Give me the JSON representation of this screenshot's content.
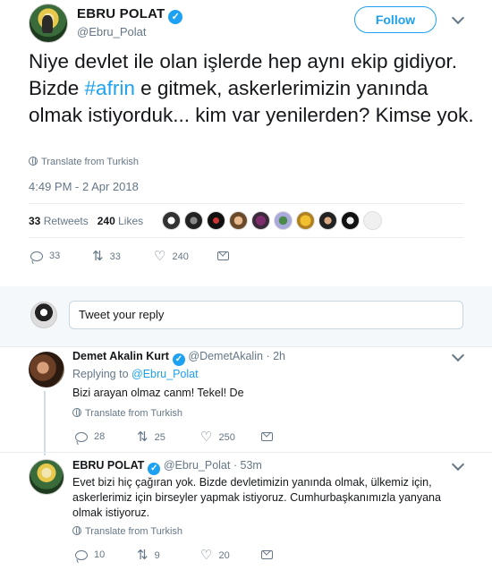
{
  "tweet": {
    "display_name": "EBRU POLAT",
    "handle": "@Ebru_Polat",
    "follow_label": "Follow",
    "text_part1": "Niye devlet ile olan işlerde hep aynı ekip gidiyor. Bizde ",
    "hashtag": "#afrin",
    "text_part2": " e gitmek, askerlerimizin yanında olmak istiyorduk... kim var yenilerden? Kimse yok.",
    "translate_label": "Translate from Turkish",
    "timestamp": "4:49 PM - 2 Apr 2018",
    "retweets_count": "33",
    "retweets_label": "Retweets",
    "likes_count": "240",
    "likes_label": "Likes",
    "actions": {
      "reply_count": "33",
      "retweet_count": "33",
      "like_count": "240"
    }
  },
  "reply_box": {
    "placeholder": "Tweet your reply"
  },
  "replies": [
    {
      "display_name": "Demet Akalin Kurt",
      "handle": "@DemetAkalin",
      "separator": "·",
      "time": "2h",
      "replying_to_label": "Replying to",
      "replying_to_handle": "@Ebru_Polat",
      "text": "Bizi arayan olmaz canm! Tekel! De",
      "translate_label": "Translate from Turkish",
      "reply_count": "28",
      "retweet_count": "25",
      "like_count": "250"
    },
    {
      "display_name": "EBRU POLAT",
      "handle": "@Ebru_Polat",
      "separator": "·",
      "time": "53m",
      "text": "Evet bizi hiç çağıran yok. Bizde devletimizin yanında olmak, ülkemiz için, askerlerimiz için birseyler yapmak istiyoruz. Cumhurbaşkanımızla yanyana olmak istiyoruz.",
      "translate_label": "Translate from Turkish",
      "reply_count": "10",
      "retweet_count": "9",
      "like_count": "20"
    }
  ],
  "colors": {
    "accent": "#1da1f2",
    "muted": "#657786",
    "text": "#14171a",
    "divider": "#e6ecf0"
  },
  "icons": [
    "verified-badge-icon",
    "chevron-down-icon",
    "globe-icon",
    "reply-icon",
    "retweet-icon",
    "like-icon",
    "direct-message-icon"
  ]
}
